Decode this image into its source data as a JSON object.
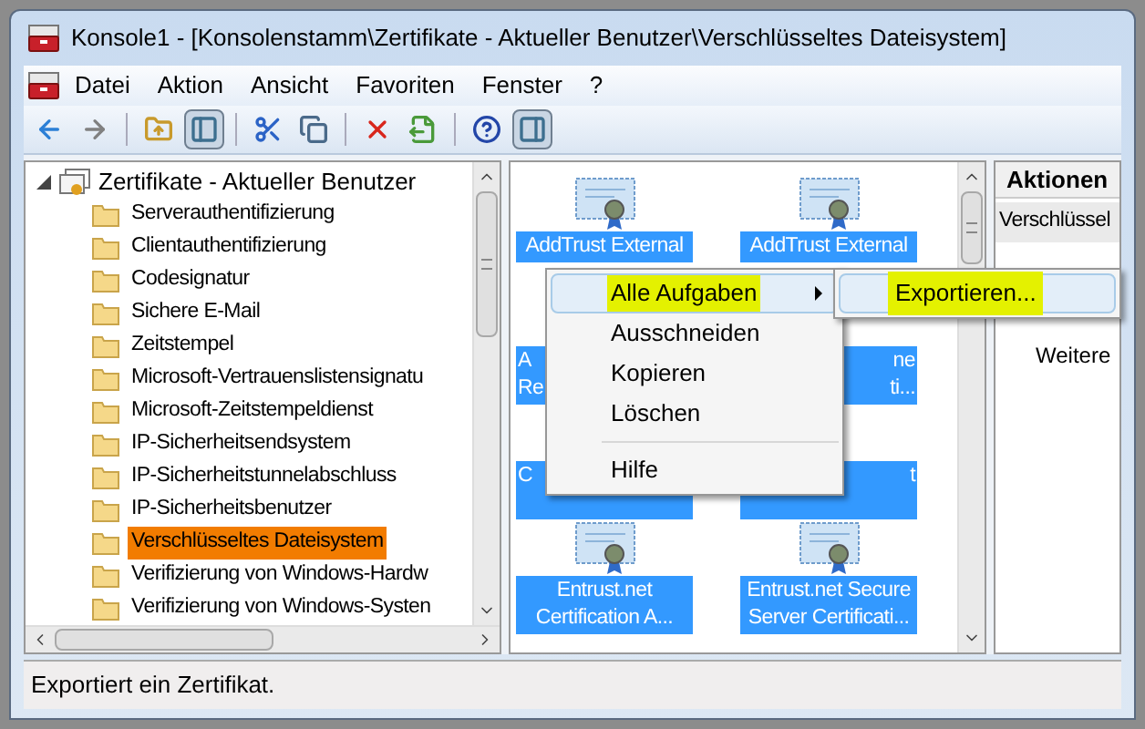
{
  "window": {
    "title": "Konsole1 - [Konsolenstamm\\Zertifikate - Aktueller Benutzer\\Verschlüsseltes Dateisystem]"
  },
  "menu": [
    "Datei",
    "Aktion",
    "Ansicht",
    "Favoriten",
    "Fenster",
    "?"
  ],
  "toolbar": [
    {
      "kind": "back",
      "pressed": false
    },
    {
      "kind": "forward",
      "pressed": false
    },
    {
      "kind": "sep"
    },
    {
      "kind": "up",
      "pressed": false
    },
    {
      "kind": "tree",
      "pressed": true
    },
    {
      "kind": "sep"
    },
    {
      "kind": "cut",
      "pressed": false
    },
    {
      "kind": "copy",
      "pressed": false
    },
    {
      "kind": "sep"
    },
    {
      "kind": "delete",
      "pressed": false
    },
    {
      "kind": "export",
      "pressed": false
    },
    {
      "kind": "sep"
    },
    {
      "kind": "help",
      "pressed": false
    },
    {
      "kind": "actionpane",
      "pressed": true
    }
  ],
  "tree": {
    "label": "Zertifikate - Aktueller Benutzer",
    "expanded": true,
    "children": [
      {
        "label": "Serverauthentifizierung",
        "selected": false
      },
      {
        "label": "Clientauthentifizierung",
        "selected": false
      },
      {
        "label": "Codesignatur",
        "selected": false
      },
      {
        "label": "Sichere E-Mail",
        "selected": false
      },
      {
        "label": "Zeitstempel",
        "selected": false
      },
      {
        "label": "Microsoft-Vertrauenslistensignatu",
        "selected": false
      },
      {
        "label": "Microsoft-Zeitstempeldienst",
        "selected": false
      },
      {
        "label": "IP-Sicherheitsendsystem",
        "selected": false
      },
      {
        "label": "IP-Sicherheitstunnelabschluss",
        "selected": false
      },
      {
        "label": "IP-Sicherheitsbenutzer",
        "selected": false
      },
      {
        "label": "Verschlüsseltes Dateisystem",
        "selected": true
      },
      {
        "label": "Verifizierung von Windows-Hardw",
        "selected": false
      },
      {
        "label": "Verifizierung von Windows-Systen",
        "selected": false
      }
    ]
  },
  "certificates": [
    {
      "lines": [
        "AddTrust External"
      ],
      "partial": false
    },
    {
      "lines": [
        "AddTrust External"
      ],
      "partial": false
    },
    {
      "lines": [
        "A",
        "Re"
      ],
      "partial": true
    },
    {
      "lines": [
        "ne",
        "ti..."
      ],
      "partial": true
    },
    {
      "lines": [
        "C"
      ],
      "partial": true
    },
    {
      "lines": [
        "t"
      ],
      "partial": true
    },
    {
      "lines": [
        "Entrust.net",
        "Certification A..."
      ],
      "partial": false
    },
    {
      "lines": [
        "Entrust.net Secure",
        "Server Certificati..."
      ],
      "partial": false
    }
  ],
  "actions": {
    "header": "Aktionen",
    "items": [
      {
        "label": "Verschlüssel",
        "kind": "group"
      },
      {
        "label": "Weitere",
        "kind": "more"
      }
    ]
  },
  "context_menu": {
    "items": [
      {
        "label": "Alle Aufgaben",
        "submenu": true,
        "selected": true,
        "highlighted": true
      },
      {
        "label": "Ausschneiden",
        "submenu": false,
        "selected": false,
        "highlighted": false
      },
      {
        "label": "Kopieren",
        "submenu": false,
        "selected": false,
        "highlighted": false
      },
      {
        "label": "Löschen",
        "submenu": false,
        "selected": false,
        "highlighted": false
      },
      {
        "kind": "separator"
      },
      {
        "label": "Hilfe",
        "submenu": false,
        "selected": false,
        "highlighted": false
      }
    ]
  },
  "submenu": {
    "items": [
      {
        "label": "Exportieren...",
        "selected": true,
        "highlighted": true
      }
    ]
  },
  "status_bar": "Exportiert ein Zertifikat."
}
